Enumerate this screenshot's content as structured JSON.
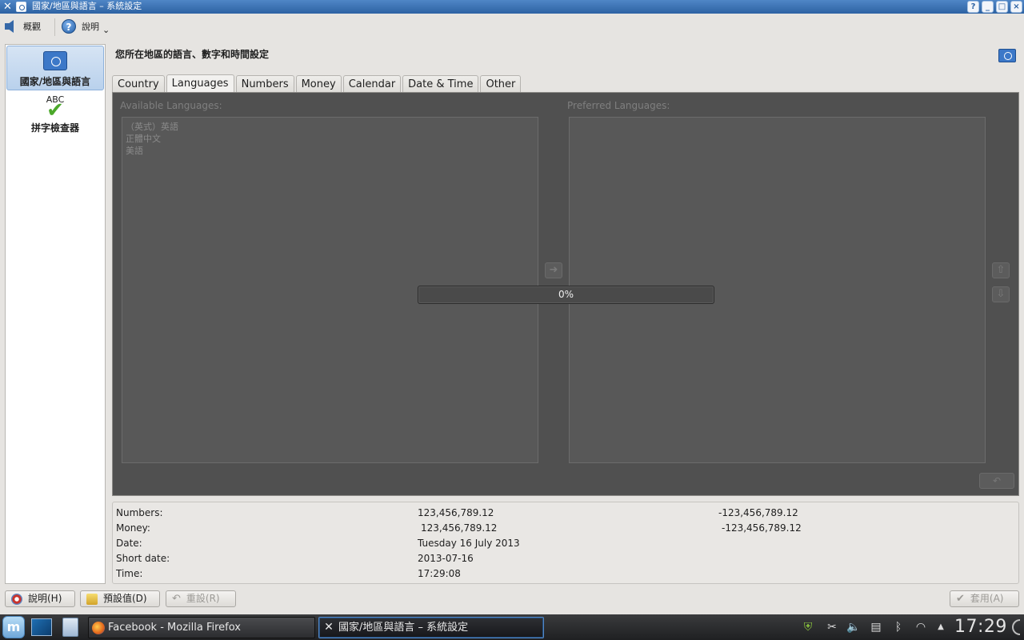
{
  "window": {
    "title": "國家/地區與語言 – 系統設定",
    "controls": [
      "?",
      "_",
      "□",
      "×"
    ]
  },
  "toolbar": {
    "back_label": "概觀",
    "help_label": "說明",
    "help_caret": "⌄"
  },
  "sidebar": {
    "items": [
      {
        "label": "國家/地區與語言",
        "icon": "un-flag-icon",
        "active": true
      },
      {
        "label": "拼字檢查器",
        "icon_text": "ABC",
        "icon": "spellcheck-icon",
        "active": false
      }
    ]
  },
  "header": {
    "title": "您所在地區的語言、數字和時間設定"
  },
  "tabs": [
    {
      "label": "Country",
      "active": false
    },
    {
      "label": "Languages",
      "active": true
    },
    {
      "label": "Numbers",
      "active": false
    },
    {
      "label": "Money",
      "active": false
    },
    {
      "label": "Calendar",
      "active": false
    },
    {
      "label": "Date & Time",
      "active": false
    },
    {
      "label": "Other",
      "active": false
    }
  ],
  "languages": {
    "available_caption": "Available Languages:",
    "preferred_caption": "Preferred Languages:",
    "available": [
      "（英式）英語",
      "正體中文",
      "美語"
    ],
    "preferred": []
  },
  "progress": {
    "value": 0,
    "label": "0%"
  },
  "preview": {
    "rows": [
      {
        "label": "Numbers:",
        "positive": "123,456,789.12",
        "negative": "-123,456,789.12"
      },
      {
        "label": "Money:",
        "positive": "123,456,789.12",
        "negative": "-123,456,789.12"
      },
      {
        "label": "Date:",
        "positive": "Tuesday 16 July 2013",
        "negative": ""
      },
      {
        "label": "Short date:",
        "positive": "2013-07-16",
        "negative": ""
      },
      {
        "label": "Time:",
        "positive": "17:29:08",
        "negative": ""
      }
    ]
  },
  "buttons": {
    "help": "說明(H)",
    "defaults": "預設值(D)",
    "reset": "重設(R)",
    "apply": "套用(A)"
  },
  "taskbar": {
    "tasks": [
      {
        "label": "Facebook - Mozilla Firefox",
        "active": false
      },
      {
        "label": "國家/地區與語言 – 系統設定",
        "active": true
      }
    ],
    "clock": "17:29"
  },
  "colors": {
    "titlebar": "#2d62a3",
    "pane_disabled": "#505050",
    "progress_fill": "#3f6fa8"
  }
}
